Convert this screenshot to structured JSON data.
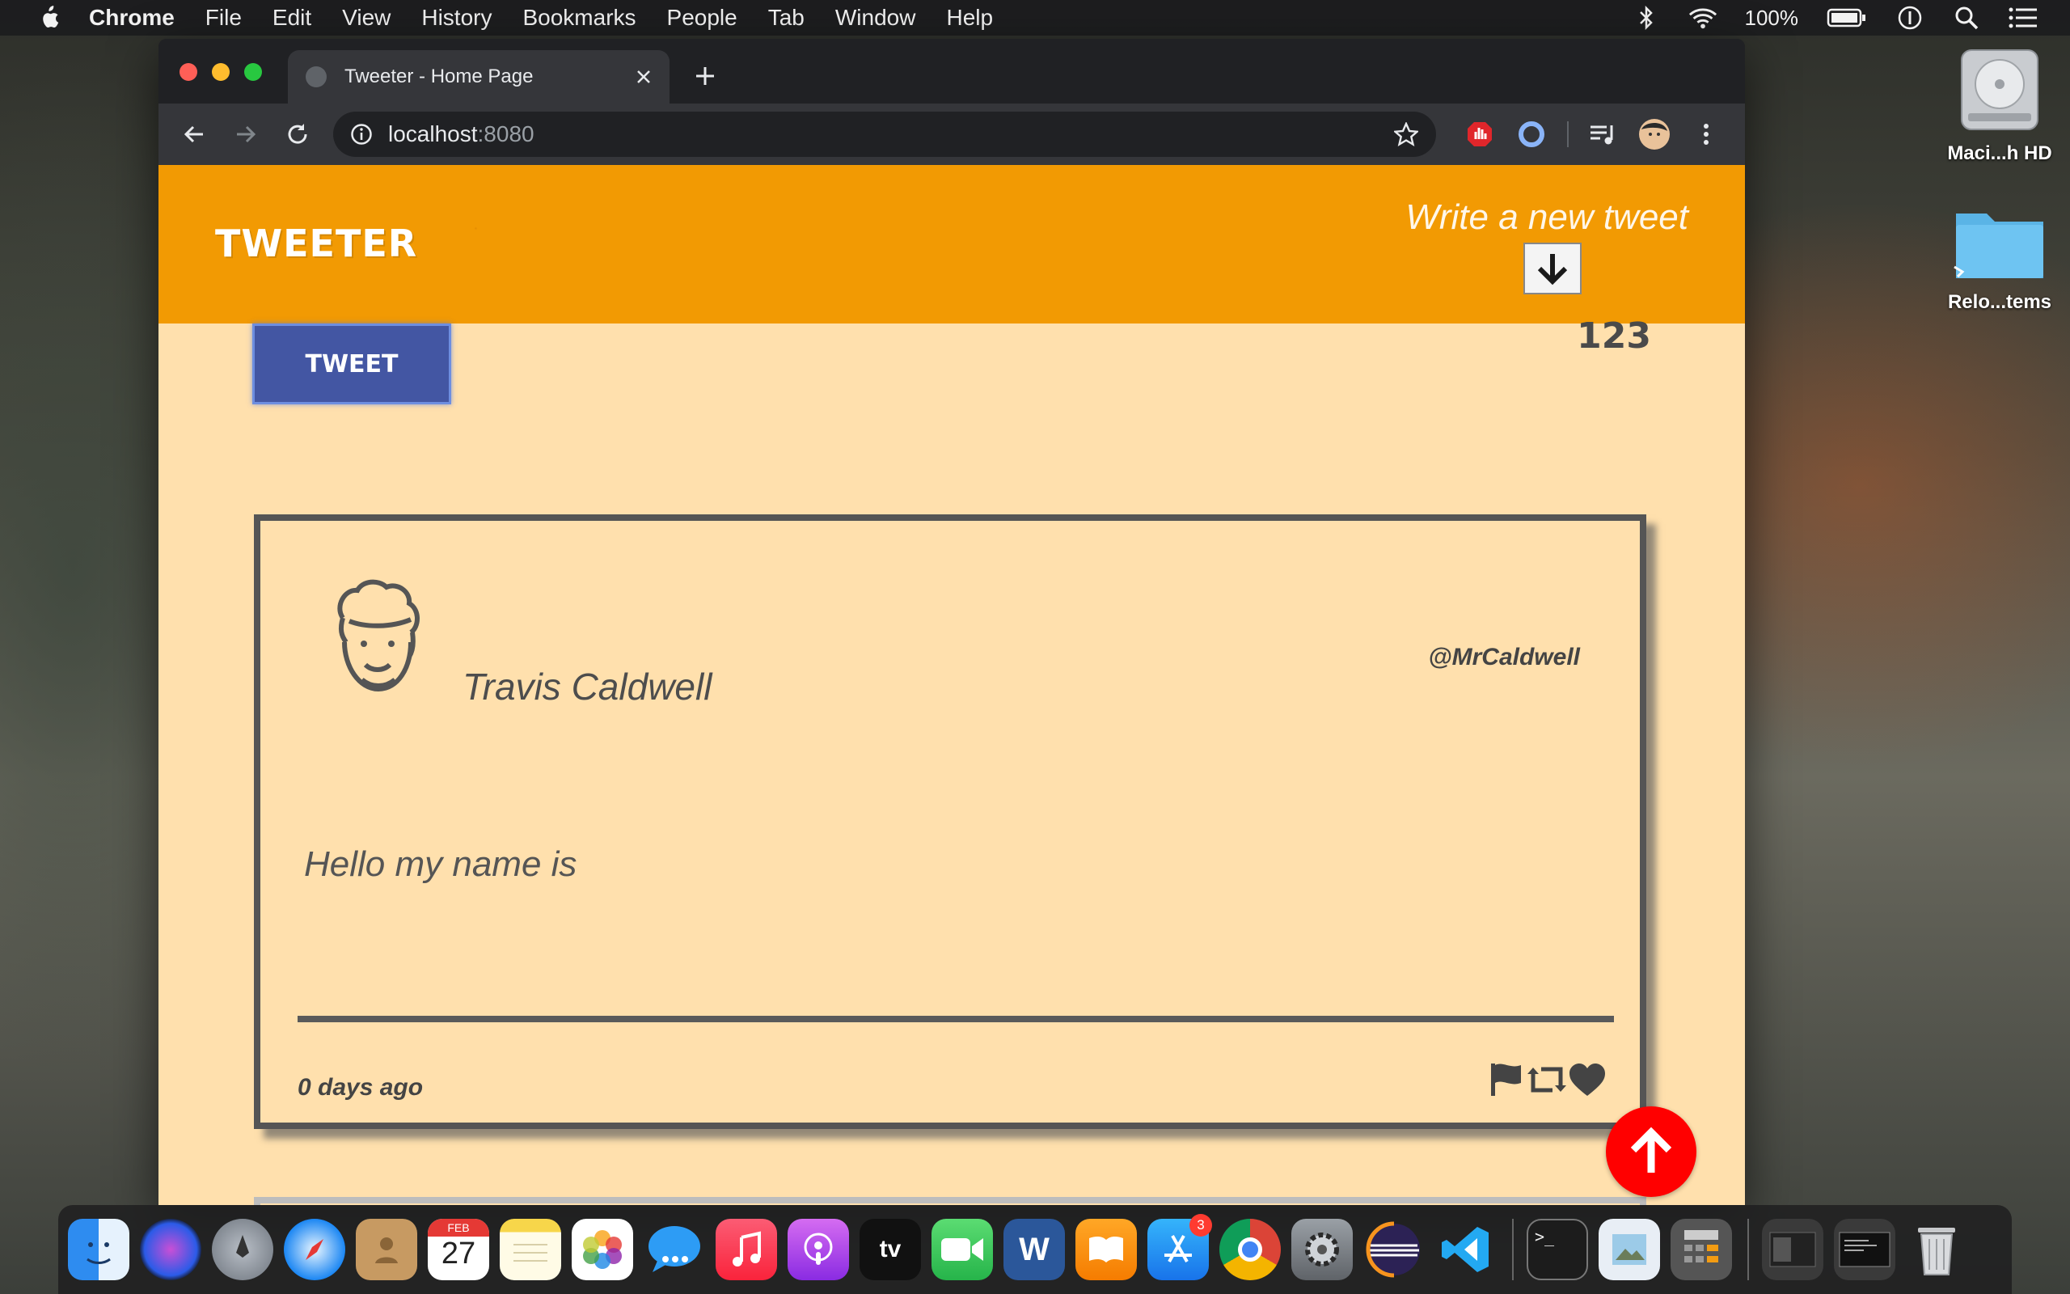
{
  "menubar": {
    "app_name": "Chrome",
    "items": [
      "File",
      "Edit",
      "View",
      "History",
      "Bookmarks",
      "People",
      "Tab",
      "Window",
      "Help"
    ],
    "battery": "100%"
  },
  "desktop": {
    "icons": [
      {
        "label": "Maci...h HD",
        "icon": "hard-drive-icon"
      },
      {
        "label": "Relo...tems",
        "icon": "folder-icon"
      }
    ]
  },
  "browser": {
    "tab_title": "Tweeter - Home Page",
    "url_host": "localhost",
    "url_port": ":8080"
  },
  "page": {
    "brand": "TWEETER",
    "compose_label": "Write a new tweet",
    "tweet_button": "TWEET",
    "char_counter": "123",
    "tweets": [
      {
        "name": "Travis Caldwell",
        "handle": "@MrCaldwell",
        "content": "Hello my name is",
        "time": "0 days ago",
        "actions": [
          "flag-icon",
          "retweet-icon",
          "heart-icon"
        ]
      }
    ]
  },
  "dock": {
    "items": [
      "Finder",
      "Siri",
      "Launchpad",
      "Safari",
      "Contacts",
      "Calendar",
      "Notes",
      "Photos",
      "Messages",
      "Music",
      "Podcasts",
      "TV",
      "FaceTime",
      "Word",
      "Books",
      "App Store",
      "Chrome",
      "System Preferences",
      "Eclipse",
      "VS Code",
      "Terminal",
      "Preview",
      "Calculator",
      "Window",
      "Window 2",
      "Trash"
    ],
    "calendar_month": "FEB",
    "calendar_day": "27",
    "appstore_badge": "3",
    "tv_label": "tv"
  },
  "colors": {
    "nav_bg": "#f29a03",
    "page_bg": "#ffe0ad",
    "tweet_button": "#4356a3",
    "scroll_top": "#ff0000"
  }
}
